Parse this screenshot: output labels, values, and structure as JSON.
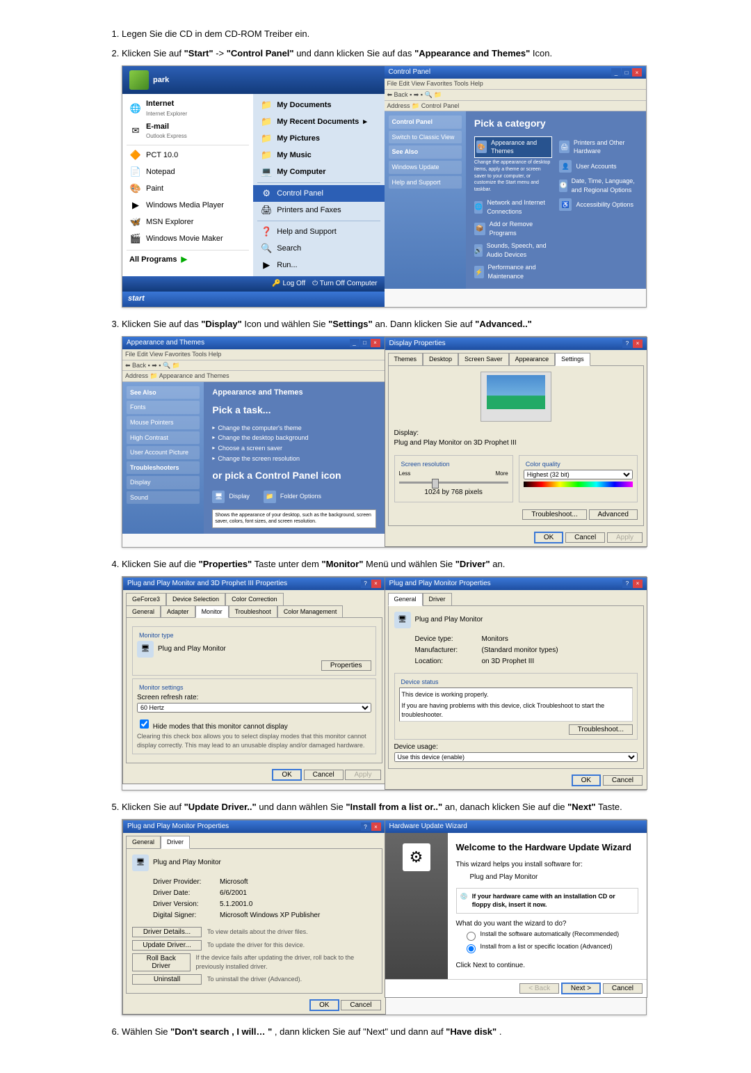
{
  "steps": {
    "s1": "Legen Sie die CD in dem CD-ROM Treiber ein.",
    "s2_a": "Klicken Sie auf ",
    "s2_b": " ->",
    "s2_c": " und dann klicken Sie auf das",
    "s2_d": " Icon.",
    "s3_a": "Klicken Sie auf das ",
    "s3_b": " Icon und wählen Sie ",
    "s3_c": " an. Dann klicken Sie auf ",
    "s4_a": "Klicken Sie auf die ",
    "s4_b": " Taste unter dem ",
    "s4_c": " Menü und wählen Sie ",
    "s4_d": " an.",
    "s5_a": "Klicken Sie auf ",
    "s5_b": " und dann wählen Sie ",
    "s5_c": " an, danach klicken Sie auf die ",
    "s5_d": " Taste.",
    "s6_a": "Wählen Sie ",
    "s6_b": ", dann klicken Sie auf \"Next\" und dann auf ",
    "s6_c": "."
  },
  "bold": {
    "start": "\"Start\"",
    "control_panel": "\"Control Panel\"",
    "appearance": "\"Appearance and Themes\"",
    "display": "\"Display\"",
    "settings": "\"Settings\"",
    "advanced": "\"Advanced..\"",
    "properties": "\"Properties\"",
    "monitor": "\"Monitor\"",
    "driver": "\"Driver\"",
    "update_driver": "\"Update Driver..\"",
    "install_from": "\"Install from a list or..\"",
    "next": "\"Next\"",
    "dont_search": "\"Don't search , I will… \"",
    "have_disk": "\"Have disk\""
  },
  "startmenu": {
    "user": "park",
    "left": [
      "Internet",
      "E-mail",
      "PCT 10.0",
      "Notepad",
      "Paint",
      "Windows Media Player",
      "MSN Explorer",
      "Windows Movie Maker"
    ],
    "left_sub": [
      "Internet Explorer",
      "Outlook Express"
    ],
    "all_programs": "All Programs",
    "right": [
      "My Documents",
      "My Recent Documents",
      "My Pictures",
      "My Music",
      "My Computer",
      "Control Panel",
      "Printers and Faxes",
      "Help and Support",
      "Search",
      "Run..."
    ],
    "logoff": "Log Off",
    "turnoff": "Turn Off Computer",
    "start": "start"
  },
  "cpanel1": {
    "title": "Control Panel",
    "menu": "File   Edit   View   Favorites   Tools   Help",
    "back": "Back",
    "addr": "Address",
    "addr_v": "Control Panel",
    "side_h": "Control Panel",
    "side1": "Switch to Classic View",
    "side_h2": "See Also",
    "side2": "Windows Update",
    "side3": "Help and Support",
    "heading": "Pick a category",
    "cats": [
      "Appearance and Themes",
      "Printers and Other Hardware",
      "Network and Internet Connections",
      "User Accounts",
      "Add or Remove Programs",
      "Date, Time, Language, and Regional Options",
      "Sounds, Speech, and Audio Devices",
      "Accessibility Options",
      "Performance and Maintenance"
    ],
    "cat_desc": "Change the appearance of desktop items, apply a theme or screen saver to your computer, or customize the Start menu and taskbar."
  },
  "cpanel2": {
    "title": "Appearance and Themes",
    "heading": "Appearance and Themes",
    "pick_task": "Pick a task...",
    "tasks": [
      "Change the computer's theme",
      "Change the desktop background",
      "Choose a screen saver",
      "Change the screen resolution"
    ],
    "or_pick": "or pick a Control Panel icon",
    "icons": [
      "Display",
      "Folder Options"
    ],
    "side_h": "See Also",
    "s1": "Fonts",
    "s2": "Mouse Pointers",
    "s3": "High Contrast",
    "s4": "User Account Picture",
    "tb_h": "Troubleshooters",
    "tb1": "Display",
    "tb2": "Sound"
  },
  "dispprop": {
    "title": "Display Properties",
    "tabs": [
      "Themes",
      "Desktop",
      "Screen Saver",
      "Appearance",
      "Settings"
    ],
    "display_lbl": "Display:",
    "display_v": "Plug and Play Monitor on 3D Prophet III",
    "res_grp": "Screen resolution",
    "less": "Less",
    "more": "More",
    "res_v": "1024 by 768 pixels",
    "col_grp": "Color quality",
    "col_v": "Highest (32 bit)",
    "ts": "Troubleshoot...",
    "adv": "Advanced",
    "ok": "OK",
    "cancel": "Cancel",
    "apply": "Apply"
  },
  "advprop": {
    "title": "Plug and Play Monitor and 3D Prophet III Properties",
    "tabs1": [
      "GeForce3",
      "Device Selection",
      "Color Correction"
    ],
    "tabs2": [
      "General",
      "Adapter",
      "Monitor",
      "Troubleshoot",
      "Color Management"
    ],
    "montype": "Monitor type",
    "mon": "Plug and Play Monitor",
    "props": "Properties",
    "monset": "Monitor settings",
    "refresh": "Screen refresh rate:",
    "hz": "60 Hertz",
    "cb": "Hide modes that this monitor cannot display",
    "cb_desc": "Clearing this check box allows you to select display modes that this monitor cannot display correctly. This may lead to an unusable display and/or damaged hardware.",
    "ok": "OK",
    "cancel": "Cancel",
    "apply": "Apply"
  },
  "monprop1": {
    "title": "Plug and Play Monitor Properties",
    "tabs": [
      "General",
      "Driver"
    ],
    "name": "Plug and Play Monitor",
    "dt_k": "Device type:",
    "dt_v": "Monitors",
    "mf_k": "Manufacturer:",
    "mf_v": "(Standard monitor types)",
    "loc_k": "Location:",
    "loc_v": "on 3D Prophet III",
    "ds_grp": "Device status",
    "ds1": "This device is working properly.",
    "ds2": "If you are having problems with this device, click Troubleshoot to start the troubleshooter.",
    "ts": "Troubleshoot...",
    "du_grp": "Device usage:",
    "du_v": "Use this device (enable)",
    "ok": "OK",
    "cancel": "Cancel"
  },
  "monprop2": {
    "title": "Plug and Play Monitor Properties",
    "tabs": [
      "General",
      "Driver"
    ],
    "name": "Plug and Play Monitor",
    "dp_k": "Driver Provider:",
    "dp_v": "Microsoft",
    "dd_k": "Driver Date:",
    "dd_v": "6/6/2001",
    "dv_k": "Driver Version:",
    "dv_v": "5.1.2001.0",
    "ds_k": "Digital Signer:",
    "ds_v": "Microsoft Windows XP Publisher",
    "bd": "Driver Details...",
    "bd_d": "To view details about the driver files.",
    "bu": "Update Driver...",
    "bu_d": "To update the driver for this device.",
    "br": "Roll Back Driver",
    "br_d": "If the device fails after updating the driver, roll back to the previously installed driver.",
    "bx": "Uninstall",
    "bx_d": "To uninstall the driver (Advanced).",
    "ok": "OK",
    "cancel": "Cancel"
  },
  "wizard": {
    "title": "Hardware Update Wizard",
    "h": "Welcome to the Hardware Update Wizard",
    "p1": "This wizard helps you install software for:",
    "dev": "Plug and Play Monitor",
    "cd": "If your hardware came with an installation CD or floppy disk, insert it now.",
    "q": "What do you want the wizard to do?",
    "o1": "Install the software automatically (Recommended)",
    "o2": "Install from a list or specific location (Advanced)",
    "cont": "Click Next to continue.",
    "back": "< Back",
    "next": "Next >",
    "cancel": "Cancel"
  }
}
